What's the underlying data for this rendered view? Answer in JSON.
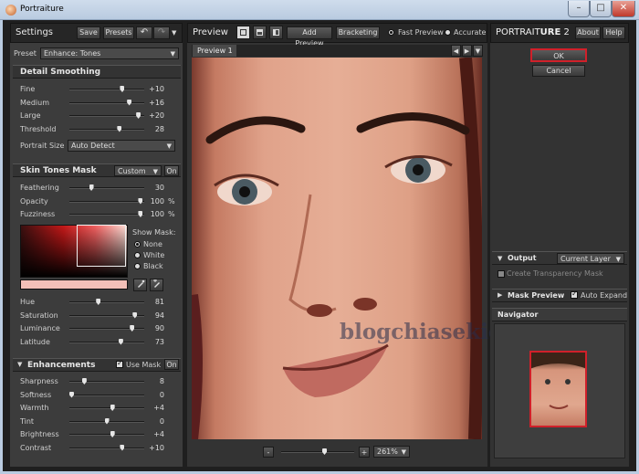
{
  "window": {
    "title": "Portraiture",
    "min": "–",
    "max": "□",
    "close": "✕"
  },
  "settings": {
    "title": "Settings",
    "save": "Save",
    "presets": "Presets",
    "undo": "↶",
    "redo": "↷",
    "preset_label": "Preset",
    "preset_value": "Enhance: Tones"
  },
  "detail": {
    "title": "Detail Smoothing",
    "sliders": [
      {
        "label": "Fine",
        "value": "+10",
        "pos": 0.72
      },
      {
        "label": "Medium",
        "value": "+16",
        "pos": 0.82
      },
      {
        "label": "Large",
        "value": "+20",
        "pos": 0.95
      },
      {
        "label": "Threshold",
        "value": "28",
        "pos": 0.68
      }
    ],
    "portrait_size_label": "Portrait Size",
    "portrait_size_value": "Auto Detect"
  },
  "skin": {
    "title": "Skin Tones Mask",
    "mode": "Custom",
    "on": "On",
    "sliders": [
      {
        "label": "Feathering",
        "value": "30",
        "unit": "",
        "pos": 0.28
      },
      {
        "label": "Opacity",
        "value": "100",
        "unit": "%",
        "pos": 0.98
      },
      {
        "label": "Fuzziness",
        "value": "100",
        "unit": "%",
        "pos": 0.98
      }
    ],
    "show_mask_label": "Show Mask:",
    "mask_options": [
      "None",
      "White",
      "Black"
    ],
    "mask_selected": 0,
    "sliders2": [
      {
        "label": "Hue",
        "value": "81",
        "pos": 0.38
      },
      {
        "label": "Saturation",
        "value": "94",
        "pos": 0.9
      },
      {
        "label": "Luminance",
        "value": "90",
        "pos": 0.86
      },
      {
        "label": "Latitude",
        "value": "73",
        "pos": 0.7
      }
    ]
  },
  "enh": {
    "title": "Enhancements",
    "use_mask": "Use Mask",
    "on": "On",
    "sliders": [
      {
        "label": "Sharpness",
        "value": "8",
        "pos": 0.18
      },
      {
        "label": "Softness",
        "value": "0",
        "pos": 0.0
      },
      {
        "label": "Warmth",
        "value": "+4",
        "pos": 0.58
      },
      {
        "label": "Tint",
        "value": "0",
        "pos": 0.5
      },
      {
        "label": "Brightness",
        "value": "+4",
        "pos": 0.58
      },
      {
        "label": "Contrast",
        "value": "+10",
        "pos": 0.72
      }
    ]
  },
  "preview": {
    "title": "Preview",
    "add_preview": "Add Preview",
    "bracketing": "Bracketing",
    "fast": "Fast Preview",
    "accurate": "Accurate",
    "tab": "Preview 1",
    "zoom": "261%",
    "minus": "-",
    "plus": "+",
    "zoom_pos": 0.6
  },
  "right": {
    "logo_a": "PORTRAIT",
    "logo_b": "URE",
    "logo_c": "2",
    "about": "About",
    "help": "Help",
    "ok": "OK",
    "cancel": "Cancel",
    "output_label": "Output",
    "output_value": "Current Layer",
    "create_transparency": "Create Transparency Mask",
    "mask_preview": "Mask Preview",
    "auto_expand": "Auto Expand",
    "navigator": "Navigator"
  },
  "watermark": "blogchiasekienthuc.com",
  "colors": {
    "ok_border": "#d0202a",
    "nav_box": "#d0202a",
    "accent": "#e6e6e6"
  }
}
